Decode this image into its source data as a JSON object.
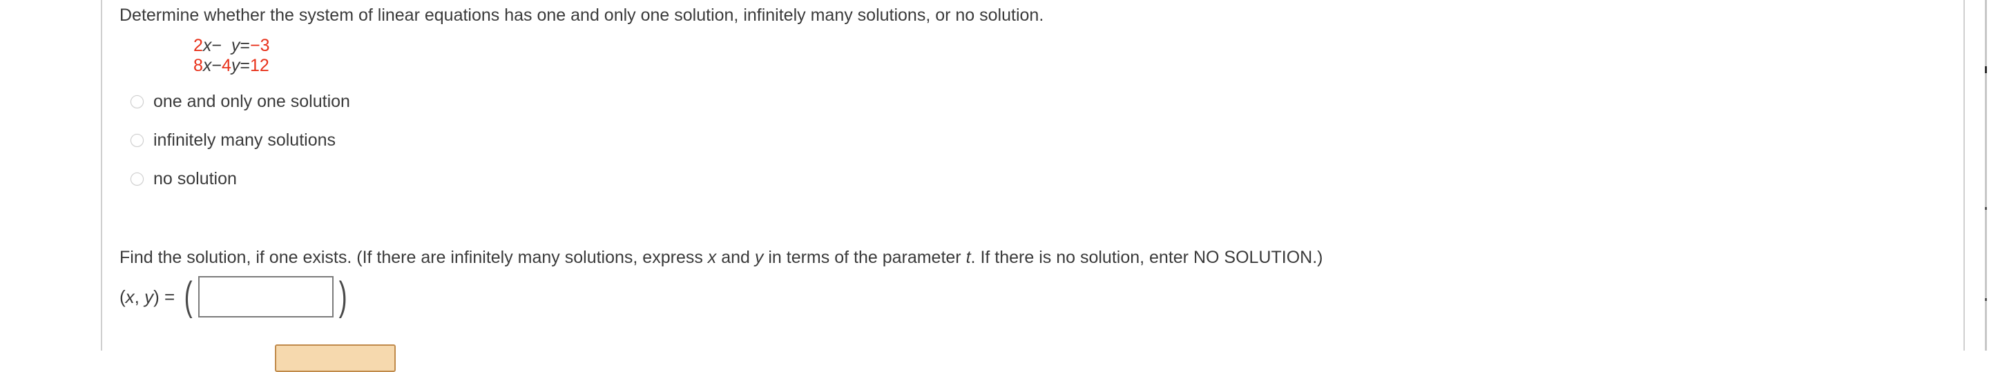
{
  "prompt": "Determine whether the system of linear equations has one and only one solution, infinitely many solutions, or no solution.",
  "system": {
    "colors": {
      "number": "#e8311a",
      "variable": "#3a3a3a",
      "operator": "#3a3a3a"
    },
    "equations": [
      {
        "coefficient_x": "2",
        "var_x": "x",
        "operator": "−",
        "coefficient_y": "",
        "var_y": "y",
        "equals": "=",
        "rhs": "−3"
      },
      {
        "coefficient_x": "8",
        "var_x": "x",
        "operator": "−",
        "coefficient_y": "4",
        "var_y": "y",
        "equals": "=",
        "rhs": "12"
      }
    ]
  },
  "choices": [
    {
      "label": "one and only one solution",
      "selected": false
    },
    {
      "label": "infinitely many solutions",
      "selected": false
    },
    {
      "label": "no solution",
      "selected": false
    }
  ],
  "subprompt": {
    "part1": "Find the solution, if one exists. (If there are infinitely many solutions, express ",
    "var_x": "x",
    "part2": " and ",
    "var_y": "y",
    "part3": " in terms of the parameter ",
    "var_t": "t",
    "part4": ". If there is no solution, enter NO SOLUTION.)"
  },
  "answer": {
    "label_open": "(",
    "label_x": "x",
    "label_comma": ", ",
    "label_y": "y",
    "label_close": ")",
    "label_equals": " = ",
    "paren_open": "(",
    "paren_close": ")",
    "value": "",
    "placeholder": ""
  },
  "bottom_button": {
    "label": "",
    "border_color": "#c08a4a",
    "fill_color": "#f6d9ae"
  }
}
